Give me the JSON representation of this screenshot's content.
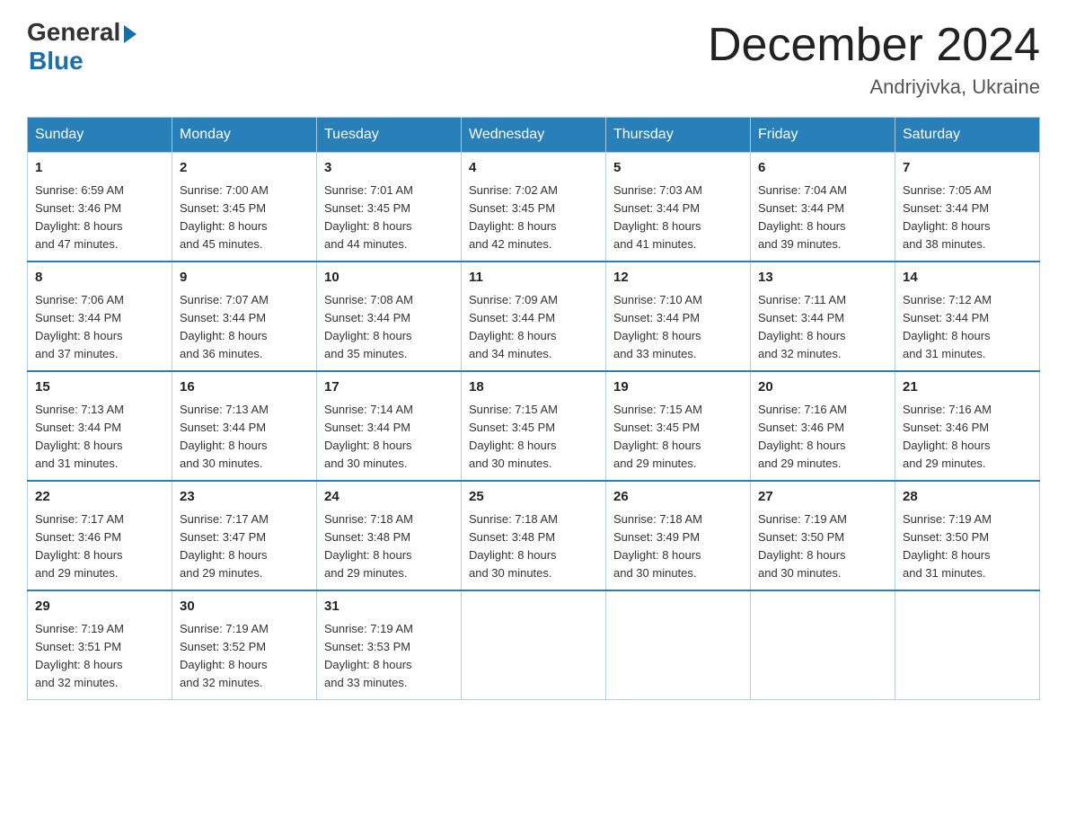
{
  "header": {
    "logo_general": "General",
    "logo_blue": "Blue",
    "month_title": "December 2024",
    "location": "Andriyivka, Ukraine"
  },
  "weekdays": [
    "Sunday",
    "Monday",
    "Tuesday",
    "Wednesday",
    "Thursday",
    "Friday",
    "Saturday"
  ],
  "weeks": [
    [
      {
        "day": "1",
        "sunrise": "6:59 AM",
        "sunset": "3:46 PM",
        "daylight": "8 hours and 47 minutes."
      },
      {
        "day": "2",
        "sunrise": "7:00 AM",
        "sunset": "3:45 PM",
        "daylight": "8 hours and 45 minutes."
      },
      {
        "day": "3",
        "sunrise": "7:01 AM",
        "sunset": "3:45 PM",
        "daylight": "8 hours and 44 minutes."
      },
      {
        "day": "4",
        "sunrise": "7:02 AM",
        "sunset": "3:45 PM",
        "daylight": "8 hours and 42 minutes."
      },
      {
        "day": "5",
        "sunrise": "7:03 AM",
        "sunset": "3:44 PM",
        "daylight": "8 hours and 41 minutes."
      },
      {
        "day": "6",
        "sunrise": "7:04 AM",
        "sunset": "3:44 PM",
        "daylight": "8 hours and 39 minutes."
      },
      {
        "day": "7",
        "sunrise": "7:05 AM",
        "sunset": "3:44 PM",
        "daylight": "8 hours and 38 minutes."
      }
    ],
    [
      {
        "day": "8",
        "sunrise": "7:06 AM",
        "sunset": "3:44 PM",
        "daylight": "8 hours and 37 minutes."
      },
      {
        "day": "9",
        "sunrise": "7:07 AM",
        "sunset": "3:44 PM",
        "daylight": "8 hours and 36 minutes."
      },
      {
        "day": "10",
        "sunrise": "7:08 AM",
        "sunset": "3:44 PM",
        "daylight": "8 hours and 35 minutes."
      },
      {
        "day": "11",
        "sunrise": "7:09 AM",
        "sunset": "3:44 PM",
        "daylight": "8 hours and 34 minutes."
      },
      {
        "day": "12",
        "sunrise": "7:10 AM",
        "sunset": "3:44 PM",
        "daylight": "8 hours and 33 minutes."
      },
      {
        "day": "13",
        "sunrise": "7:11 AM",
        "sunset": "3:44 PM",
        "daylight": "8 hours and 32 minutes."
      },
      {
        "day": "14",
        "sunrise": "7:12 AM",
        "sunset": "3:44 PM",
        "daylight": "8 hours and 31 minutes."
      }
    ],
    [
      {
        "day": "15",
        "sunrise": "7:13 AM",
        "sunset": "3:44 PM",
        "daylight": "8 hours and 31 minutes."
      },
      {
        "day": "16",
        "sunrise": "7:13 AM",
        "sunset": "3:44 PM",
        "daylight": "8 hours and 30 minutes."
      },
      {
        "day": "17",
        "sunrise": "7:14 AM",
        "sunset": "3:44 PM",
        "daylight": "8 hours and 30 minutes."
      },
      {
        "day": "18",
        "sunrise": "7:15 AM",
        "sunset": "3:45 PM",
        "daylight": "8 hours and 30 minutes."
      },
      {
        "day": "19",
        "sunrise": "7:15 AM",
        "sunset": "3:45 PM",
        "daylight": "8 hours and 29 minutes."
      },
      {
        "day": "20",
        "sunrise": "7:16 AM",
        "sunset": "3:46 PM",
        "daylight": "8 hours and 29 minutes."
      },
      {
        "day": "21",
        "sunrise": "7:16 AM",
        "sunset": "3:46 PM",
        "daylight": "8 hours and 29 minutes."
      }
    ],
    [
      {
        "day": "22",
        "sunrise": "7:17 AM",
        "sunset": "3:46 PM",
        "daylight": "8 hours and 29 minutes."
      },
      {
        "day": "23",
        "sunrise": "7:17 AM",
        "sunset": "3:47 PM",
        "daylight": "8 hours and 29 minutes."
      },
      {
        "day": "24",
        "sunrise": "7:18 AM",
        "sunset": "3:48 PM",
        "daylight": "8 hours and 29 minutes."
      },
      {
        "day": "25",
        "sunrise": "7:18 AM",
        "sunset": "3:48 PM",
        "daylight": "8 hours and 30 minutes."
      },
      {
        "day": "26",
        "sunrise": "7:18 AM",
        "sunset": "3:49 PM",
        "daylight": "8 hours and 30 minutes."
      },
      {
        "day": "27",
        "sunrise": "7:19 AM",
        "sunset": "3:50 PM",
        "daylight": "8 hours and 30 minutes."
      },
      {
        "day": "28",
        "sunrise": "7:19 AM",
        "sunset": "3:50 PM",
        "daylight": "8 hours and 31 minutes."
      }
    ],
    [
      {
        "day": "29",
        "sunrise": "7:19 AM",
        "sunset": "3:51 PM",
        "daylight": "8 hours and 32 minutes."
      },
      {
        "day": "30",
        "sunrise": "7:19 AM",
        "sunset": "3:52 PM",
        "daylight": "8 hours and 32 minutes."
      },
      {
        "day": "31",
        "sunrise": "7:19 AM",
        "sunset": "3:53 PM",
        "daylight": "8 hours and 33 minutes."
      },
      null,
      null,
      null,
      null
    ]
  ],
  "labels": {
    "sunrise": "Sunrise:",
    "sunset": "Sunset:",
    "daylight": "Daylight:"
  }
}
